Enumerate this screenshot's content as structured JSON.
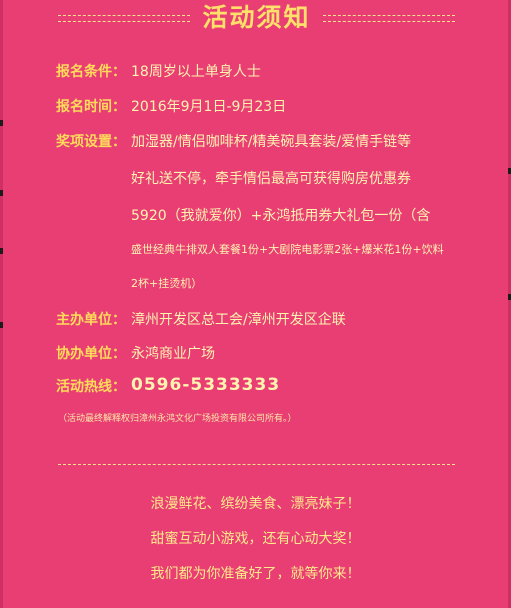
{
  "title": "活动须知",
  "items": {
    "condition": {
      "label": "报名条件：",
      "value": "18周岁以上单身人士"
    },
    "time": {
      "label": "报名时间：",
      "value": "2016年9月1日-9月23日"
    },
    "prizes": {
      "label": "奖项设置：",
      "lines": [
        "加湿器/情侣咖啡杯/精美碗具套装/爱情手链等",
        "好礼送不停，牵手情侣最高可获得购房优惠券",
        "5920（我就爱你）+永鸿抵用券大礼包一份（含",
        "盛世经典牛排双人套餐1份+大剧院电影票2张+爆米花1份+饮料",
        "2杯+挂烫机）"
      ]
    },
    "host": {
      "label": "主办单位：",
      "value": "漳州开发区总工会/漳州开发区企联"
    },
    "cohost": {
      "label": "协办单位：",
      "value": "永鸿商业广场"
    },
    "hotline": {
      "label": "活动热线：",
      "value": "0596-5333333"
    }
  },
  "note": "（活动最终解释权归漳州永鸿文化广场投资有限公司所有。）",
  "slogans": [
    "浪漫鲜花、缤纷美食、漂亮妹子！",
    "甜蜜互动小游戏，还有心动大奖！",
    "我们都为你准备好了，就等你来！"
  ]
}
